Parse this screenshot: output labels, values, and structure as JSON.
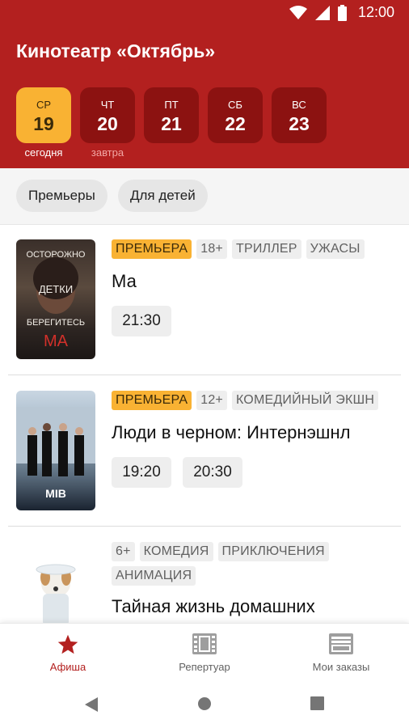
{
  "status": {
    "time": "12:00"
  },
  "app": {
    "title": "Кинотеатр «Октябрь»"
  },
  "days": [
    {
      "dow": "СР",
      "num": "19",
      "caption": "сегодня",
      "selected": true
    },
    {
      "dow": "ЧТ",
      "num": "20",
      "caption": "завтра",
      "selected": false
    },
    {
      "dow": "ПТ",
      "num": "21",
      "caption": "",
      "selected": false
    },
    {
      "dow": "СБ",
      "num": "22",
      "caption": "",
      "selected": false
    },
    {
      "dow": "ВС",
      "num": "23",
      "caption": "",
      "selected": false
    }
  ],
  "filters": [
    "Премьеры",
    "Для детей"
  ],
  "movies": [
    {
      "tags": [
        "ПРЕМЬЕРА",
        "18+",
        "ТРИЛЛЕР",
        "УЖАСЫ"
      ],
      "title": "Ма",
      "sessions": [
        "21:30"
      ],
      "poster_text": [
        "ОСТОРОЖНО",
        "ДЕТКИ",
        "БЕРЕГИТЕСЬ",
        "МА"
      ]
    },
    {
      "tags": [
        "ПРЕМЬЕРА",
        "12+",
        "КОМЕДИЙНЫЙ ЭКШН"
      ],
      "title": "Люди в черном: Интернэшнл",
      "sessions": [
        "19:20",
        "20:30"
      ],
      "poster_text": [
        "MIB"
      ]
    },
    {
      "tags": [
        "6+",
        "КОМЕДИЯ",
        "ПРИКЛЮЧЕНИЯ",
        "АНИМАЦИЯ"
      ],
      "title": "Тайная жизнь домашних",
      "sessions": []
    }
  ],
  "nav": [
    {
      "label": "Афиша",
      "icon": "star-icon",
      "active": true
    },
    {
      "label": "Репертуар",
      "icon": "film-icon",
      "active": false
    },
    {
      "label": "Мои заказы",
      "icon": "tickets-icon",
      "active": false
    }
  ],
  "colors": {
    "primary": "#b3201f",
    "day_bg": "#8c1211",
    "accent": "#f9b233"
  }
}
